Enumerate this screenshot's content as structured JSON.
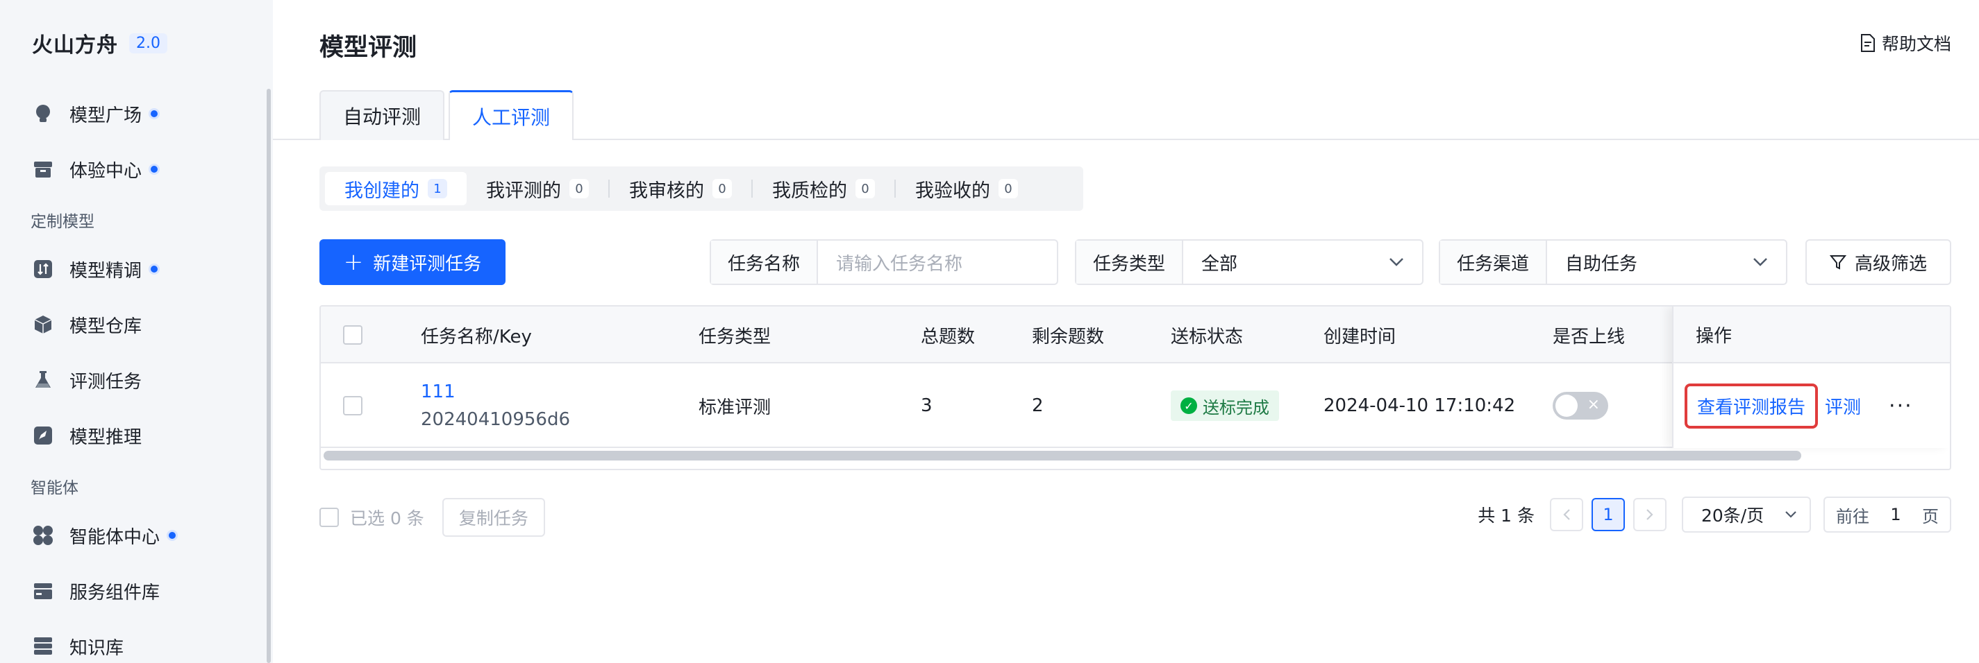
{
  "brand": {
    "name": "火山方舟",
    "version": "2.0"
  },
  "sidebar": {
    "items": [
      {
        "label": "模型广场",
        "icon": "bulb-icon",
        "dot": true
      },
      {
        "label": "体验中心",
        "icon": "box-icon",
        "dot": true
      },
      {
        "label": "模型精调",
        "icon": "tune-icon",
        "dot": true
      },
      {
        "label": "模型仓库",
        "icon": "cube-icon",
        "dot": false
      },
      {
        "label": "评测任务",
        "icon": "flask-icon",
        "dot": false
      },
      {
        "label": "模型推理",
        "icon": "rocket-icon",
        "dot": false
      },
      {
        "label": "智能体中心",
        "icon": "grid-icon",
        "dot": true
      },
      {
        "label": "服务组件库",
        "icon": "stack-icon",
        "dot": false
      },
      {
        "label": "知识库",
        "icon": "server-icon",
        "dot": false
      }
    ],
    "groups": [
      "定制模型",
      "智能体"
    ]
  },
  "header": {
    "title": "模型评测",
    "help": "帮助文档"
  },
  "tabs": [
    {
      "label": "自动评测",
      "active": false
    },
    {
      "label": "人工评测",
      "active": true
    }
  ],
  "subtabs": [
    {
      "label": "我创建的",
      "count": "1",
      "active": true
    },
    {
      "label": "我评测的",
      "count": "0",
      "active": false
    },
    {
      "label": "我审核的",
      "count": "0",
      "active": false
    },
    {
      "label": "我质检的",
      "count": "0",
      "active": false
    },
    {
      "label": "我验收的",
      "count": "0",
      "active": false
    }
  ],
  "toolbar": {
    "new_task": "新建评测任务",
    "name_filter": {
      "label": "任务名称",
      "placeholder": "请输入任务名称"
    },
    "type_filter": {
      "label": "任务类型",
      "value": "全部"
    },
    "channel_filter": {
      "label": "任务渠道",
      "value": "自助任务"
    },
    "advanced": "高级筛选"
  },
  "table": {
    "headers": [
      "任务名称/Key",
      "任务类型",
      "总题数",
      "剩余题数",
      "送标状态",
      "创建时间",
      "是否上线",
      "操作"
    ],
    "rows": [
      {
        "name": "111",
        "key": "20240410956d6",
        "type": "标准评测",
        "total": "3",
        "remaining": "2",
        "status": "送标完成",
        "created": "2024-04-10 17:10:42",
        "online": false,
        "actions": {
          "report": "查看评测报告",
          "eval": "评测",
          "more": "···"
        }
      }
    ]
  },
  "footer": {
    "selected": "已选 0 条",
    "copy": "复制任务",
    "total": "共 1 条",
    "current_page": "1",
    "page_size": "20条/页",
    "goto_prefix": "前往",
    "goto_value": "1",
    "goto_suffix": "页"
  },
  "colors": {
    "accent": "#1664ff",
    "highlight_border": "#e03c3c",
    "success": "#00b042"
  }
}
